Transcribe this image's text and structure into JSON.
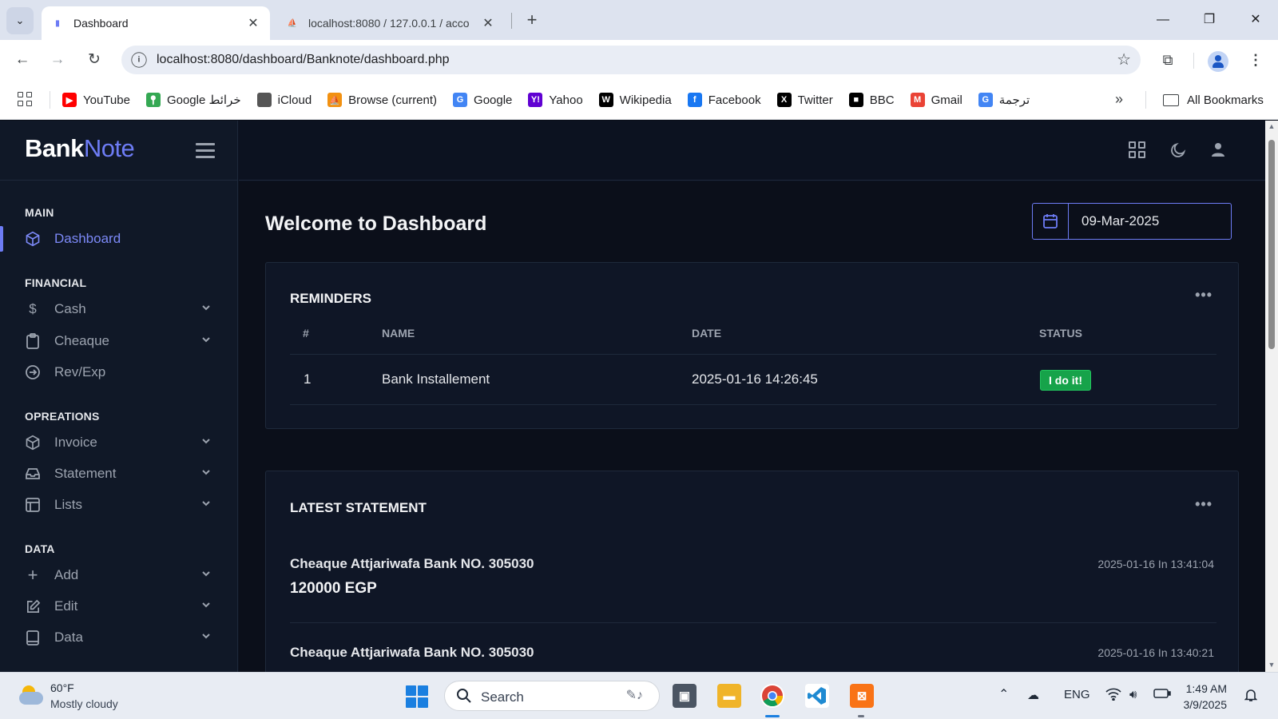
{
  "browser": {
    "tabs": [
      {
        "title": "Dashboard",
        "active": true
      },
      {
        "title": "localhost:8080 / 127.0.0.1 / acco",
        "active": false
      }
    ],
    "url": "localhost:8080/dashboard/Banknote/dashboard.php",
    "bookmarks": [
      {
        "label": "YouTube",
        "icon": "youtube-icon",
        "color": "#ff0000"
      },
      {
        "label": "Google خرائط",
        "icon": "maps-icon",
        "color": "#34a853"
      },
      {
        "label": "iCloud",
        "icon": "apple-icon",
        "color": "#555555"
      },
      {
        "label": "Browse (current)",
        "icon": "pma-icon",
        "color": "#f29111"
      },
      {
        "label": "Google",
        "icon": "google-icon",
        "color": "#4285f4"
      },
      {
        "label": "Yahoo",
        "icon": "yahoo-icon",
        "color": "#6001d2"
      },
      {
        "label": "Wikipedia",
        "icon": "wikipedia-icon",
        "color": "#000000"
      },
      {
        "label": "Facebook",
        "icon": "facebook-icon",
        "color": "#1877f2"
      },
      {
        "label": "Twitter",
        "icon": "x-icon",
        "color": "#000000"
      },
      {
        "label": "BBC",
        "icon": "bbc-icon",
        "color": "#000000"
      },
      {
        "label": "Gmail",
        "icon": "gmail-icon",
        "color": "#ea4335"
      },
      {
        "label": "ترجمة",
        "icon": "translate-icon",
        "color": "#4285f4"
      }
    ],
    "all_bookmarks": "All Bookmarks"
  },
  "app": {
    "logo_part1": "Bank",
    "logo_part2": "Note",
    "sidebar": {
      "sections": [
        {
          "title": "MAIN",
          "items": [
            {
              "label": "Dashboard",
              "icon": "cube-icon",
              "active": true,
              "has_children": false
            }
          ]
        },
        {
          "title": "FINANCIAL",
          "items": [
            {
              "label": "Cash",
              "icon": "dollar-icon",
              "has_children": true
            },
            {
              "label": "Cheaque",
              "icon": "clipboard-icon",
              "has_children": true
            },
            {
              "label": "Rev/Exp",
              "icon": "arrow-circle-icon",
              "has_children": false
            }
          ]
        },
        {
          "title": "OPREATIONS",
          "items": [
            {
              "label": "Invoice",
              "icon": "box-icon",
              "has_children": true
            },
            {
              "label": "Statement",
              "icon": "inbox-icon",
              "has_children": true
            },
            {
              "label": "Lists",
              "icon": "table-icon",
              "has_children": true
            }
          ]
        },
        {
          "title": "DATA",
          "items": [
            {
              "label": "Add",
              "icon": "plus-icon",
              "has_children": true
            },
            {
              "label": "Edit",
              "icon": "edit-icon",
              "has_children": true
            },
            {
              "label": "Data",
              "icon": "book-icon",
              "has_children": true
            }
          ]
        }
      ]
    },
    "page_title": "Welcome to Dashboard",
    "date_value": "09-Mar-2025",
    "reminders": {
      "title": "REMINDERS",
      "columns": [
        "#",
        "NAME",
        "DATE",
        "STATUS"
      ],
      "rows": [
        {
          "num": "1",
          "name": "Bank Installement",
          "date": "2025-01-16 14:26:45",
          "status": "I do it!"
        }
      ]
    },
    "latest_statement": {
      "title": "LATEST STATEMENT",
      "items": [
        {
          "title": "Cheaque Attjariwafa Bank NO. 305030",
          "amount": "120000 EGP",
          "date": "2025-01-16 In 13:41:04"
        },
        {
          "title": "Cheaque Attjariwafa Bank NO. 305030",
          "date": "2025-01-16 In 13:40:21"
        }
      ]
    }
  },
  "taskbar": {
    "temperature": "60°F",
    "condition": "Mostly cloudy",
    "search_placeholder": "Search",
    "language": "ENG",
    "time": "1:49 AM",
    "date": "3/9/2025"
  }
}
